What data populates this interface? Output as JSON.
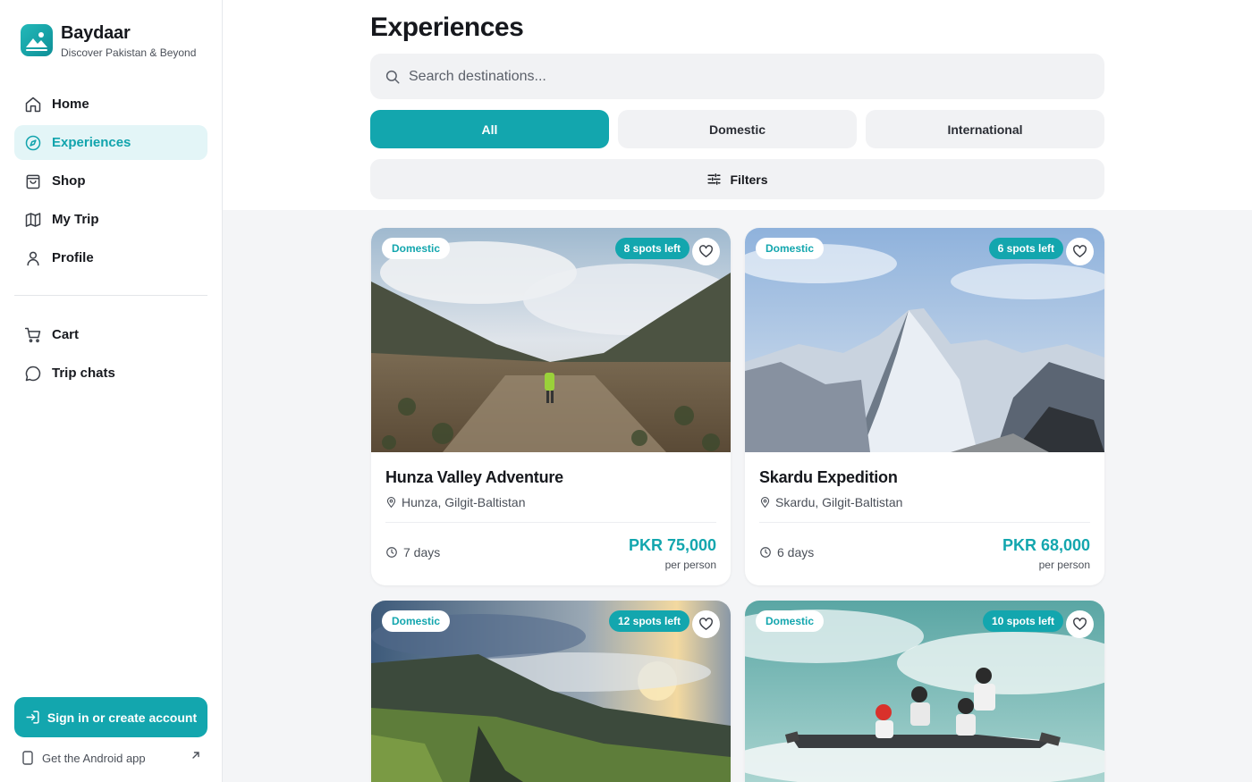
{
  "brand": {
    "name": "Baydaar",
    "tagline": "Discover Pakistan & Beyond"
  },
  "nav": {
    "primary": [
      {
        "label": "Home",
        "icon": "home-icon",
        "active": false
      },
      {
        "label": "Experiences",
        "icon": "compass-icon",
        "active": true
      },
      {
        "label": "Shop",
        "icon": "shopping-bag-icon",
        "active": false
      },
      {
        "label": "My Trip",
        "icon": "map-icon",
        "active": false
      },
      {
        "label": "Profile",
        "icon": "user-icon",
        "active": false
      }
    ],
    "secondary": [
      {
        "label": "Cart",
        "icon": "cart-icon"
      },
      {
        "label": "Trip chats",
        "icon": "chat-bubble-icon"
      }
    ],
    "signin_label": "Sign in or create account",
    "android_label": "Get the Android app"
  },
  "main": {
    "title": "Experiences",
    "search_placeholder": "Search destinations...",
    "segments": [
      "All",
      "Domestic",
      "International"
    ],
    "active_segment": "All",
    "filters_label": "Filters"
  },
  "cards": [
    {
      "type": "Domestic",
      "spots": "8 spots left",
      "title": "Hunza Valley Adventure",
      "location": "Hunza, Gilgit-Baltistan",
      "duration": "7 days",
      "price": "PKR 75,000",
      "per": "per person"
    },
    {
      "type": "Domestic",
      "spots": "6 spots left",
      "title": "Skardu Expedition",
      "location": "Skardu, Gilgit-Baltistan",
      "duration": "6 days",
      "price": "PKR 68,000",
      "per": "per person"
    },
    {
      "type": "Domestic",
      "spots": "12 spots left"
    },
    {
      "type": "Domestic",
      "spots": "10 spots left"
    }
  ],
  "colors": {
    "accent": "#13a6ae",
    "accent_soft": "#e3f5f7",
    "surface": "#f1f2f4"
  }
}
